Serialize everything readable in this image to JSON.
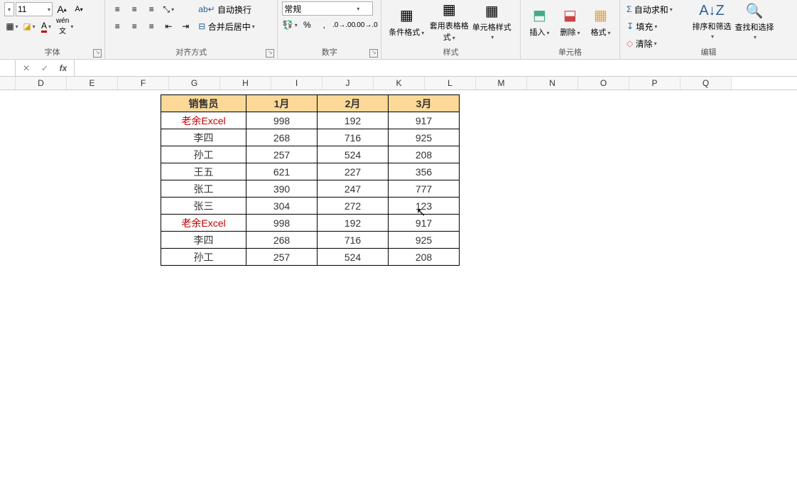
{
  "ribbon": {
    "font": {
      "size": "11",
      "grow": "A",
      "shrink": "A",
      "label": "字体"
    },
    "align": {
      "wrap_label": "自动换行",
      "merge_label": "合并后居中",
      "label": "对齐方式"
    },
    "number": {
      "format": "常规",
      "label": "数字"
    },
    "styles": {
      "cond": "条件格式",
      "table": "套用表格格式",
      "cell": "单元格样式",
      "label": "样式"
    },
    "cells": {
      "insert": "插入",
      "delete": "删除",
      "format": "格式",
      "label": "单元格"
    },
    "editing": {
      "autosum": "自动求和",
      "fill": "填充",
      "clear": "清除",
      "sort": "排序和筛选",
      "find": "查找和选择",
      "label": "编辑"
    }
  },
  "cols": [
    "",
    "D",
    "E",
    "F",
    "G",
    "H",
    "I",
    "J",
    "K",
    "L",
    "M",
    "N",
    "O",
    "P",
    "Q"
  ],
  "table": {
    "headers": [
      "销售员",
      "1月",
      "2月",
      "3月"
    ],
    "rows": [
      {
        "name": "老余Excel",
        "red": true,
        "v": [
          "998",
          "192",
          "917"
        ]
      },
      {
        "name": "李四",
        "v": [
          "268",
          "716",
          "925"
        ]
      },
      {
        "name": "孙工",
        "v": [
          "257",
          "524",
          "208"
        ]
      },
      {
        "name": "王五",
        "v": [
          "621",
          "227",
          "356"
        ]
      },
      {
        "name": "张工",
        "v": [
          "390",
          "247",
          "777"
        ]
      },
      {
        "name": "张三",
        "v": [
          "304",
          "272",
          "123"
        ]
      },
      {
        "name": "老余Excel",
        "red": true,
        "v": [
          "998",
          "192",
          "917"
        ]
      },
      {
        "name": "李四",
        "v": [
          "268",
          "716",
          "925"
        ]
      },
      {
        "name": "孙工",
        "v": [
          "257",
          "524",
          "208"
        ]
      }
    ]
  }
}
